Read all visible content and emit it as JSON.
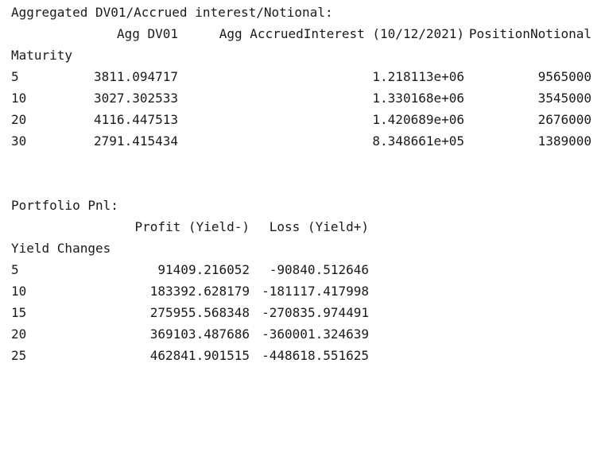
{
  "section1": {
    "title": "Aggregated DV01/Accrued interest/Notional:",
    "columns": [
      "Agg DV01",
      "Agg AccruedInterest (10/12/2021)",
      "PositionNotional"
    ],
    "index_name": "Maturity",
    "rows": [
      {
        "idx": "5",
        "c1": "3811.094717",
        "c2": "1.218113e+06",
        "c3": "9565000"
      },
      {
        "idx": "10",
        "c1": "3027.302533",
        "c2": "1.330168e+06",
        "c3": "3545000"
      },
      {
        "idx": "20",
        "c1": "4116.447513",
        "c2": "1.420689e+06",
        "c3": "2676000"
      },
      {
        "idx": "30",
        "c1": "2791.415434",
        "c2": "8.348661e+05",
        "c3": "1389000"
      }
    ]
  },
  "section2": {
    "title": "Portfolio Pnl:",
    "columns": [
      "Profit (Yield-)",
      "Loss (Yield+)"
    ],
    "index_name": "Yield Changes",
    "rows": [
      {
        "idx": "5",
        "c1": "91409.216052",
        "c2": "-90840.512646"
      },
      {
        "idx": "10",
        "c1": "183392.628179",
        "c2": "-181117.417998"
      },
      {
        "idx": "15",
        "c1": "275955.568348",
        "c2": "-270835.974491"
      },
      {
        "idx": "20",
        "c1": "369103.487686",
        "c2": "-360001.324639"
      },
      {
        "idx": "25",
        "c1": "462841.901515",
        "c2": "-448618.551625"
      }
    ]
  }
}
